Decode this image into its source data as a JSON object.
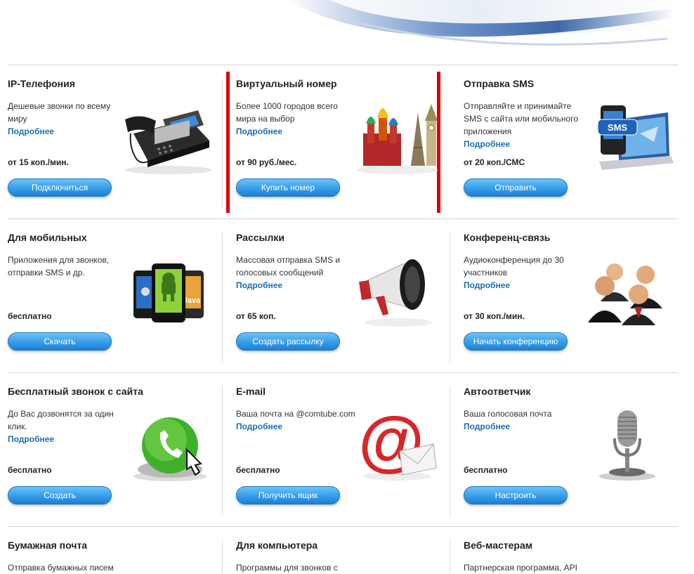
{
  "rows": [
    {
      "cells": [
        {
          "title": "IP-Телефония",
          "desc": "Дешевые звонки по всему миру",
          "more": "Подробнее",
          "price": "от 15 коп./мин.",
          "button": "Подключиться"
        },
        {
          "title": "Виртуальный номер",
          "desc": "Более 1000 городов всего мира на выбор",
          "more": "Подробнее",
          "price": "от 90 руб./мес.",
          "button": "Купить номер"
        },
        {
          "title": "Отправка SMS",
          "desc": "Отправляйте и принимайте SMS с сайта или мобильного приложения",
          "more": "Подробнее",
          "price": "от 20 коп./СМС",
          "button": "Отправить"
        }
      ]
    },
    {
      "cells": [
        {
          "title": "Для мобильных",
          "desc": "Приложения для звонков, отправки SMS и др.",
          "more": "",
          "price": "бесплатно",
          "button": "Скачать"
        },
        {
          "title": "Рассылки",
          "desc": "Массовая отправка SMS и голосовых сообщений",
          "more": "Подробнее",
          "price": "от 65 коп.",
          "button": "Создать рассылку"
        },
        {
          "title": "Конференц-связь",
          "desc": "Аудиоконференция до 30 участников",
          "more": "Подробнее",
          "price": "от 30 коп./мин.",
          "button": "Начать конференцию"
        }
      ]
    },
    {
      "cells": [
        {
          "title": "Бесплатный звонок с сайта",
          "desc": "До Вас дозвонятся за один клик.",
          "more": "Подробнее",
          "price": "бесплатно",
          "button": "Создать"
        },
        {
          "title": "E-mail",
          "desc": "Ваша почта на @comtube.com",
          "more": "Подробнее",
          "price": "бесплатно",
          "button": "Получить ящик"
        },
        {
          "title": "Автоответчик",
          "desc": "Ваша голосовая почта",
          "more": "Подробнее",
          "price": "бесплатно",
          "button": "Настроить"
        }
      ]
    },
    {
      "cells": [
        {
          "title": "Бумажная почта",
          "desc": "Отправка бумажных писем"
        },
        {
          "title": "Для компьютера",
          "desc": "Программы для звонков с"
        },
        {
          "title": "Веб-мастерам",
          "desc": "Партнерская программа, API"
        }
      ]
    }
  ],
  "icons": [
    "office-phone-icon",
    "landmarks-icon",
    "laptop-sms-icon",
    "smartphones-icon",
    "megaphone-icon",
    "conference-people-icon",
    "green-call-button-icon",
    "email-at-icon",
    "microphone-icon"
  ],
  "colors": {
    "accent_link": "#1a6fb5",
    "button_top": "#6ec2f6",
    "button_bottom": "#1b7fd6",
    "highlight_border": "#e00000"
  }
}
